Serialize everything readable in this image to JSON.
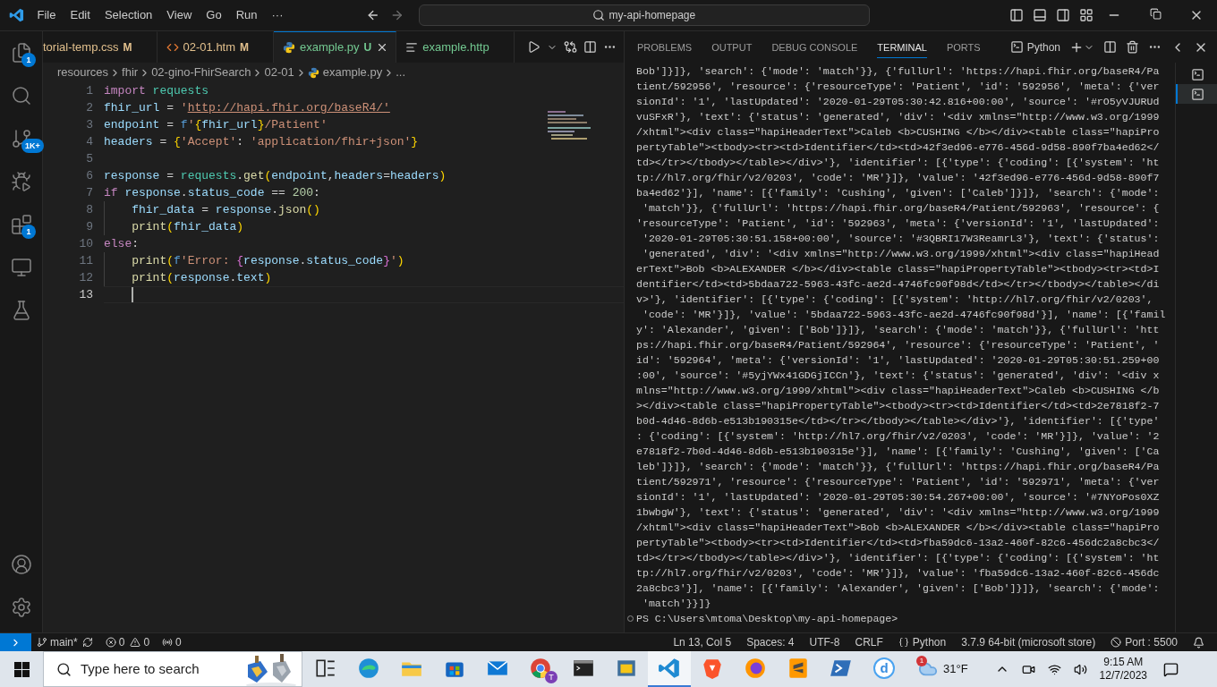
{
  "title_bar": {
    "menu": [
      "File",
      "Edit",
      "Selection",
      "View",
      "Go",
      "Run",
      "···"
    ],
    "search": "my-api-homepage"
  },
  "activity_bar": {
    "items": [
      {
        "kind": "explorer",
        "badge": "1"
      },
      {
        "kind": "search"
      },
      {
        "kind": "source_control",
        "badge": "1K+"
      },
      {
        "kind": "run"
      },
      {
        "kind": "extensions",
        "badge": "1"
      },
      {
        "kind": "remote"
      },
      {
        "kind": "testing"
      }
    ],
    "bottom": [
      {
        "kind": "account"
      },
      {
        "kind": "settings"
      }
    ]
  },
  "tabs": [
    {
      "label": "torial-temp.css",
      "status": "M",
      "kind": "css",
      "color": "#e2c08d",
      "selected": false
    },
    {
      "label": "02-01.htm",
      "status": "M",
      "kind": "html",
      "color": "#e2c08d",
      "selected": false
    },
    {
      "label": "example.py",
      "status": "U",
      "kind": "python",
      "color": "#73c991",
      "selected": true
    },
    {
      "label": "example.http",
      "kind": "http",
      "color": "#73c991",
      "selected": false
    }
  ],
  "breadcrumb": [
    {
      "label": "resources",
      "kind": "folder"
    },
    {
      "label": "fhir",
      "kind": "folder"
    },
    {
      "label": "02-gino-FhirSearch",
      "kind": "folder"
    },
    {
      "label": "02-01",
      "kind": "folder"
    },
    {
      "label": "example.py",
      "kind": "python"
    },
    {
      "label": "...",
      "kind": "more"
    }
  ],
  "editor": {
    "lines": [
      {
        "number": "1",
        "current": false,
        "tokens": [
          {
            "text": "import",
            "kind": "keyword"
          },
          {
            "text": " requests",
            "kind": "class"
          }
        ]
      },
      {
        "number": "2",
        "current": false,
        "tokens": [
          {
            "text": "fhir_url",
            "kind": "variable"
          },
          {
            "text": " = ",
            "kind": "plain"
          },
          {
            "text": "'",
            "kind": "string"
          },
          {
            "text": "http://hapi.fhir.org/baseR4/'",
            "kind": "link"
          }
        ]
      },
      {
        "number": "3",
        "current": false,
        "tokens": [
          {
            "text": "endpoint",
            "kind": "variable"
          },
          {
            "text": " = ",
            "kind": "plain"
          },
          {
            "text": "f",
            "kind": "storage"
          },
          {
            "text": "'",
            "kind": "string"
          },
          {
            "text": "{",
            "kind": "bracket1"
          },
          {
            "text": "fhir_url",
            "kind": "variable"
          },
          {
            "text": "}",
            "kind": "bracket1"
          },
          {
            "text": "/Patient'",
            "kind": "string"
          }
        ]
      },
      {
        "number": "4",
        "current": false,
        "tokens": [
          {
            "text": "headers",
            "kind": "variable"
          },
          {
            "text": " = ",
            "kind": "plain"
          },
          {
            "text": "{",
            "kind": "bracket1"
          },
          {
            "text": "'Accept'",
            "kind": "string"
          },
          {
            "text": ": ",
            "kind": "plain"
          },
          {
            "text": "'application/fhir+json'",
            "kind": "string"
          },
          {
            "text": "}",
            "kind": "bracket1"
          }
        ]
      },
      {
        "number": "5",
        "current": false
      },
      {
        "number": "6",
        "current": false,
        "tokens": [
          {
            "text": "response",
            "kind": "variable"
          },
          {
            "text": " = ",
            "kind": "plain"
          },
          {
            "text": "requests",
            "kind": "class"
          },
          {
            "text": ".",
            "kind": "plain"
          },
          {
            "text": "get",
            "kind": "func"
          },
          {
            "text": "(",
            "kind": "bracket1"
          },
          {
            "text": "endpoint",
            "kind": "variable"
          },
          {
            "text": ",",
            "kind": "plain"
          },
          {
            "text": "headers",
            "kind": "variable"
          },
          {
            "text": "=",
            "kind": "plain"
          },
          {
            "text": "headers",
            "kind": "variable"
          },
          {
            "text": ")",
            "kind": "bracket1"
          }
        ]
      },
      {
        "number": "7",
        "current": false,
        "tokens": [
          {
            "text": "if",
            "kind": "keyword"
          },
          {
            "text": " response",
            "kind": "variable"
          },
          {
            "text": ".",
            "kind": "plain"
          },
          {
            "text": "status_code",
            "kind": "variable"
          },
          {
            "text": " == ",
            "kind": "plain"
          },
          {
            "text": "200",
            "kind": "number"
          },
          {
            "text": ":",
            "kind": "plain"
          }
        ]
      },
      {
        "number": "8",
        "current": false,
        "indented": true,
        "guide": true,
        "tokens": [
          {
            "text": "fhir_data",
            "kind": "variable"
          },
          {
            "text": " = ",
            "kind": "plain"
          },
          {
            "text": "response",
            "kind": "variable"
          },
          {
            "text": ".",
            "kind": "plain"
          },
          {
            "text": "json",
            "kind": "func"
          },
          {
            "text": "()",
            "kind": "bracket1"
          }
        ]
      },
      {
        "number": "9",
        "current": false,
        "indented": true,
        "guide": true,
        "tokens": [
          {
            "text": "print",
            "kind": "func"
          },
          {
            "text": "(",
            "kind": "bracket1"
          },
          {
            "text": "fhir_data",
            "kind": "variable"
          },
          {
            "text": ")",
            "kind": "bracket1"
          }
        ]
      },
      {
        "number": "10",
        "current": false,
        "tokens": [
          {
            "text": "else",
            "kind": "keyword"
          },
          {
            "text": ":",
            "kind": "plain"
          }
        ]
      },
      {
        "number": "11",
        "current": false,
        "indented": true,
        "guide": true,
        "tokens": [
          {
            "text": "print",
            "kind": "func"
          },
          {
            "text": "(",
            "kind": "bracket1"
          },
          {
            "text": "f",
            "kind": "storage"
          },
          {
            "text": "'Error: ",
            "kind": "string"
          },
          {
            "text": "{",
            "kind": "bracket2"
          },
          {
            "text": "response",
            "kind": "variable"
          },
          {
            "text": ".",
            "kind": "plain"
          },
          {
            "text": "status_code",
            "kind": "variable"
          },
          {
            "text": "}",
            "kind": "bracket2"
          },
          {
            "text": "'",
            "kind": "string"
          },
          {
            "text": ")",
            "kind": "bracket1"
          }
        ]
      },
      {
        "number": "12",
        "current": false,
        "indented": true,
        "guide": true,
        "tokens": [
          {
            "text": "print",
            "kind": "func"
          },
          {
            "text": "(",
            "kind": "bracket1"
          },
          {
            "text": "response",
            "kind": "variable"
          },
          {
            "text": ".",
            "kind": "plain"
          },
          {
            "text": "text",
            "kind": "variable"
          },
          {
            "text": ")",
            "kind": "bracket1"
          }
        ]
      },
      {
        "number": "13",
        "current": true,
        "indented": true,
        "guide": false
      }
    ]
  },
  "panel": {
    "tabs": [
      {
        "label": "PROBLEMS",
        "selected": false
      },
      {
        "label": "OUTPUT",
        "selected": false
      },
      {
        "label": "DEBUG CONSOLE",
        "selected": false
      },
      {
        "label": "TERMINAL",
        "selected": true
      },
      {
        "label": "PORTS",
        "selected": false
      }
    ],
    "terminal_name": "Python",
    "terminals": [
      {
        "selected": false
      },
      {
        "selected": true
      }
    ],
    "lines": [
      "Bob']}]}, 'search': {'mode': 'match'}}, {'fullUrl': 'https://hapi.fhir.org/baseR4/Pa",
      "tient/592956', 'resource': {'resourceType': 'Patient', 'id': '592956', 'meta': {'ver",
      "sionId': '1', 'lastUpdated': '2020-01-29T05:30:42.816+00:00', 'source': '#rO5yVJURUd",
      "vuSFxR'}, 'text': {'status': 'generated', 'div': '<div xmlns=\"http://www.w3.org/1999",
      "/xhtml\"><div class=\"hapiHeaderText\">Caleb <b>CUSHING </b></div><table class=\"hapiPro",
      "pertyTable\"><tbody><tr><td>Identifier</td><td>42f3ed96-e776-456d-9d58-890f7ba4ed62</",
      "td></tr></tbody></table></div>'}, 'identifier': [{'type': {'coding': [{'system': 'ht",
      "tp://hl7.org/fhir/v2/0203', 'code': 'MR'}]}, 'value': '42f3ed96-e776-456d-9d58-890f7",
      "ba4ed62'}], 'name': [{'family': 'Cushing', 'given': ['Caleb']}]}, 'search': {'mode':",
      " 'match'}}, {'fullUrl': 'https://hapi.fhir.org/baseR4/Patient/592963', 'resource': {",
      "'resourceType': 'Patient', 'id': '592963', 'meta': {'versionId': '1', 'lastUpdated':",
      " '2020-01-29T05:30:51.158+00:00', 'source': '#3QBRI17W3ReamrL3'}, 'text': {'status':",
      " 'generated', 'div': '<div xmlns=\"http://www.w3.org/1999/xhtml\"><div class=\"hapiHead",
      "erText\">Bob <b>ALEXANDER </b></div><table class=\"hapiPropertyTable\"><tbody><tr><td>I",
      "dentifier</td><td>5bdaa722-5963-43fc-ae2d-4746fc90f98d</td></tr></tbody></table></di",
      "v>'}, 'identifier': [{'type': {'coding': [{'system': 'http://hl7.org/fhir/v2/0203',",
      " 'code': 'MR'}]}, 'value': '5bdaa722-5963-43fc-ae2d-4746fc90f98d'}], 'name': [{'famil",
      "y': 'Alexander', 'given': ['Bob']}]}, 'search': {'mode': 'match'}}, {'fullUrl': 'htt",
      "ps://hapi.fhir.org/baseR4/Patient/592964', 'resource': {'resourceType': 'Patient', '",
      "id': '592964', 'meta': {'versionId': '1', 'lastUpdated': '2020-01-29T05:30:51.259+00",
      ":00', 'source': '#5yjYWx41GDGjICCn'}, 'text': {'status': 'generated', 'div': '<div x",
      "mlns=\"http://www.w3.org/1999/xhtml\"><div class=\"hapiHeaderText\">Caleb <b>CUSHING </b",
      "></div><table class=\"hapiPropertyTable\"><tbody><tr><td>Identifier</td><td>2e7818f2-7",
      "b0d-4d46-8d6b-e513b190315e</td></tr></tbody></table></div>'}, 'identifier': [{'type'",
      ": {'coding': [{'system': 'http://hl7.org/fhir/v2/0203', 'code': 'MR'}]}, 'value': '2",
      "e7818f2-7b0d-4d46-8d6b-e513b190315e'}], 'name': [{'family': 'Cushing', 'given': ['Ca",
      "leb']}]}, 'search': {'mode': 'match'}}, {'fullUrl': 'https://hapi.fhir.org/baseR4/Pa",
      "tient/592971', 'resource': {'resourceType': 'Patient', 'id': '592971', 'meta': {'ver",
      "sionId': '1', 'lastUpdated': '2020-01-29T05:30:54.267+00:00', 'source': '#7NYoPos0XZ",
      "1bwbgW'}, 'text': {'status': 'generated', 'div': '<div xmlns=\"http://www.w3.org/1999",
      "/xhtml\"><div class=\"hapiHeaderText\">Bob <b>ALEXANDER </b></div><table class=\"hapiPro",
      "pertyTable\"><tbody><tr><td>Identifier</td><td>fba59dc6-13a2-460f-82c6-456dc2a8cbc3</",
      "td></tr></tbody></table></div>'}, 'identifier': [{'type': {'coding': [{'system': 'ht",
      "tp://hl7.org/fhir/v2/0203', 'code': 'MR'}]}, 'value': 'fba59dc6-13a2-460f-82c6-456dc",
      "2a8cbc3'}], 'name': [{'family': 'Alexander', 'given': ['Bob']}]}, 'search': {'mode':",
      " 'match'}}]}"
    ],
    "prompt": "PS C:\\Users\\mtoma\\Desktop\\my-api-homepage>"
  },
  "status_bar": {
    "branch": "main*",
    "errors": "0",
    "warnings": "0",
    "ports": "0",
    "position": "Ln 13, Col 5",
    "indentation": "Spaces: 4",
    "encoding": "UTF-8",
    "eol": "CRLF",
    "language": "Python",
    "interpreter": "3.7.9 64-bit (microsoft store)",
    "live_server": "Port : 5500"
  },
  "taskbar": {
    "search_placeholder": "Type here to search",
    "apps": [
      {
        "kind": "task_view",
        "active": false
      },
      {
        "kind": "edge",
        "active": false
      },
      {
        "kind": "explorer",
        "active": false
      },
      {
        "kind": "store",
        "active": false
      },
      {
        "kind": "mail",
        "active": false
      },
      {
        "kind": "chrome",
        "badge": "T",
        "active": false
      },
      {
        "kind": "terminal",
        "active": false
      },
      {
        "kind": "python",
        "active": false
      },
      {
        "kind": "vscode",
        "active": true
      },
      {
        "kind": "brave",
        "active": false
      },
      {
        "kind": "firefox",
        "active": false
      },
      {
        "kind": "sublime",
        "active": false
      },
      {
        "kind": "powershell",
        "active": false
      },
      {
        "kind": "letter",
        "label": "d",
        "active": false
      }
    ],
    "weather": {
      "badge": "1",
      "temperature": "31°F"
    },
    "time": "9:15 AM",
    "date": "12/7/2023"
  }
}
